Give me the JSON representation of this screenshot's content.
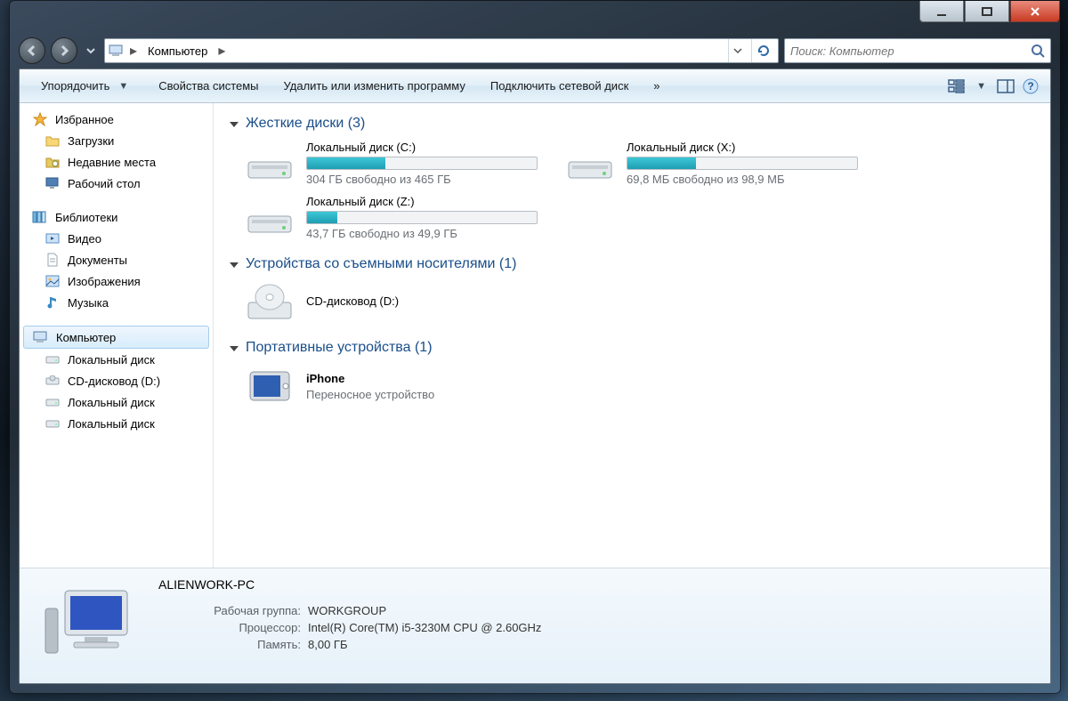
{
  "titlebar": {
    "min": "",
    "max": "",
    "close": ""
  },
  "address": {
    "crumb": "Компьютер",
    "search_placeholder": "Поиск: Компьютер"
  },
  "toolbar": {
    "organize": "Упорядочить",
    "sys_props": "Свойства системы",
    "uninstall": "Удалить или изменить программу",
    "map_drive": "Подключить сетевой диск",
    "overflow": "»"
  },
  "sidebar": {
    "favorites": "Избранное",
    "downloads": "Загрузки",
    "recent": "Недавние места",
    "desktop": "Рабочий стол",
    "libraries": "Библиотеки",
    "videos": "Видео",
    "documents": "Документы",
    "pictures": "Изображения",
    "music": "Музыка",
    "computer": "Компьютер",
    "drive_c": "Локальный диск",
    "drive_d": "CD-дисковод (D:)",
    "drive_x": "Локальный диск",
    "drive_z": "Локальный диск"
  },
  "content": {
    "hdd_header": "Жесткие диски (3)",
    "removable_header": "Устройства со съемными носителями (1)",
    "portable_header": "Портативные устройства (1)",
    "drives": [
      {
        "name": "Локальный диск (C:)",
        "free": "304 ГБ свободно из 465 ГБ",
        "fill_pct": 34
      },
      {
        "name": "Локальный диск (X:)",
        "free": "69,8 МБ свободно из 98,9 МБ",
        "fill_pct": 30
      },
      {
        "name": "Локальный диск (Z:)",
        "free": "43,7 ГБ свободно из 49,9 ГБ",
        "fill_pct": 13
      }
    ],
    "cd": {
      "name": "CD-дисковод (D:)"
    },
    "iphone": {
      "name": "iPhone",
      "desc": "Переносное устройство"
    }
  },
  "details": {
    "name": "ALIENWORK-PC",
    "workgroup_lbl": "Рабочая группа:",
    "workgroup": "WORKGROUP",
    "cpu_lbl": "Процессор:",
    "cpu": "Intel(R) Core(TM) i5-3230M CPU @ 2.60GHz",
    "mem_lbl": "Память:",
    "mem": "8,00 ГБ"
  }
}
